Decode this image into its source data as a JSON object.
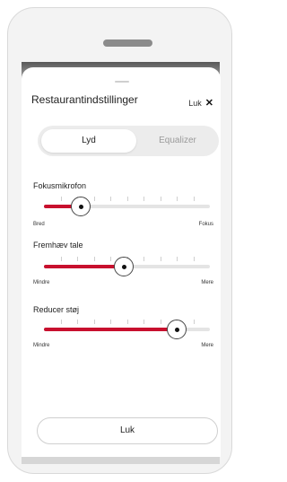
{
  "sheet": {
    "title": "Restaurantindstillinger",
    "close_label": "Luk",
    "close_icon": "close-icon"
  },
  "tabs": [
    {
      "label": "Lyd",
      "active": true
    },
    {
      "label": "Equalizer",
      "active": false
    }
  ],
  "sliders": [
    {
      "label": "Fokusmikrofon",
      "min_label": "Bred",
      "max_label": "Fokus",
      "value_fraction": 0.22
    },
    {
      "label": "Fremhæv tale",
      "min_label": "Mindre",
      "max_label": "Mere",
      "value_fraction": 0.48
    },
    {
      "label": "Reducer støj",
      "min_label": "Mindre",
      "max_label": "Mere",
      "value_fraction": 0.8
    }
  ],
  "bottom_button": {
    "label": "Luk"
  },
  "colors": {
    "accent": "#c8102e",
    "track": "#e4e4e4"
  }
}
